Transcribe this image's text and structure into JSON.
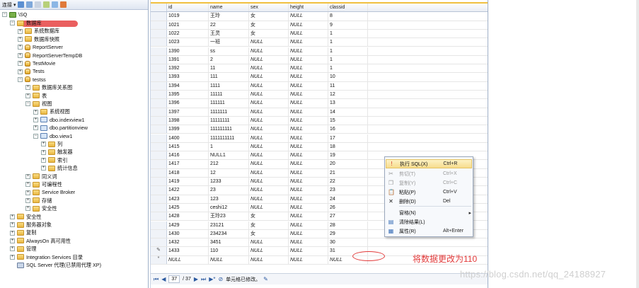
{
  "object_explorer": {
    "toolbar": {
      "connect_label": "连接 ▾"
    },
    "server_name": "\\SQ",
    "tree": [
      {
        "label": "数据库",
        "level": 1,
        "icon": "folder",
        "expand": "minus"
      },
      {
        "label": "系统数据库",
        "level": 2,
        "icon": "folder",
        "expand": "plus"
      },
      {
        "label": "数据库快照",
        "level": 2,
        "icon": "folder",
        "expand": "plus"
      },
      {
        "label": "ReportServer",
        "level": 2,
        "icon": "db",
        "expand": "plus"
      },
      {
        "label": "ReportServerTempDB",
        "level": 2,
        "icon": "db",
        "expand": "plus"
      },
      {
        "label": "TestMovie",
        "level": 2,
        "icon": "db",
        "expand": "plus"
      },
      {
        "label": "Tests",
        "level": 2,
        "icon": "db",
        "expand": "plus"
      },
      {
        "label": "testss",
        "level": 2,
        "icon": "db",
        "expand": "minus"
      },
      {
        "label": "数据库关系图",
        "level": 3,
        "icon": "folder",
        "expand": "plus"
      },
      {
        "label": "表",
        "level": 3,
        "icon": "folder",
        "expand": "plus"
      },
      {
        "label": "视图",
        "level": 3,
        "icon": "folder",
        "expand": "minus"
      },
      {
        "label": "系统视图",
        "level": 4,
        "icon": "folder",
        "expand": "plus"
      },
      {
        "label": "dbo.indexview1",
        "level": 4,
        "icon": "view",
        "expand": "plus"
      },
      {
        "label": "dbo.partitionview",
        "level": 4,
        "icon": "view",
        "expand": "plus"
      },
      {
        "label": "dbo.view1",
        "level": 4,
        "icon": "view",
        "expand": "minus"
      },
      {
        "label": "列",
        "level": 5,
        "icon": "folder",
        "expand": "plus"
      },
      {
        "label": "触发器",
        "level": 5,
        "icon": "folder",
        "expand": "plus"
      },
      {
        "label": "索引",
        "level": 5,
        "icon": "folder",
        "expand": "plus"
      },
      {
        "label": "统计信息",
        "level": 5,
        "icon": "folder",
        "expand": "plus"
      },
      {
        "label": "同义词",
        "level": 3,
        "icon": "folder",
        "expand": "plus"
      },
      {
        "label": "可编程性",
        "level": 3,
        "icon": "folder",
        "expand": "plus"
      },
      {
        "label": "Service Broker",
        "level": 3,
        "icon": "folder",
        "expand": "plus"
      },
      {
        "label": "存储",
        "level": 3,
        "icon": "folder",
        "expand": "plus"
      },
      {
        "label": "安全性",
        "level": 3,
        "icon": "folder",
        "expand": "plus"
      },
      {
        "label": "安全性",
        "level": 1,
        "icon": "folder",
        "expand": "plus"
      },
      {
        "label": "服务器对象",
        "level": 1,
        "icon": "folder",
        "expand": "plus"
      },
      {
        "label": "复制",
        "level": 1,
        "icon": "folder",
        "expand": "plus"
      },
      {
        "label": "AlwaysOn 高可用性",
        "level": 1,
        "icon": "folder",
        "expand": "plus"
      },
      {
        "label": "管理",
        "level": 1,
        "icon": "folder",
        "expand": "plus"
      },
      {
        "label": "Integration Services 目录",
        "level": 1,
        "icon": "folder",
        "expand": "plus"
      },
      {
        "label": "SQL Server 代理(已禁用代理 XP)",
        "level": 1,
        "icon": "agent",
        "expand": "none"
      }
    ]
  },
  "grid": {
    "columns": [
      "id",
      "name",
      "sex",
      "height",
      "classid"
    ],
    "rows": [
      [
        "1019",
        "王玲",
        "女",
        "NULL",
        "8"
      ],
      [
        "1021",
        "22",
        "女",
        "NULL",
        "9"
      ],
      [
        "1022",
        "王灵",
        "女",
        "NULL",
        "1"
      ],
      [
        "1023",
        "一班",
        "NULL",
        "NULL",
        "1"
      ],
      [
        "1390",
        "ss",
        "NULL",
        "NULL",
        "1"
      ],
      [
        "1391",
        "2",
        "NULL",
        "NULL",
        "1"
      ],
      [
        "1392",
        "11",
        "NULL",
        "NULL",
        "1"
      ],
      [
        "1393",
        "111",
        "NULL",
        "NULL",
        "10"
      ],
      [
        "1394",
        "1111",
        "NULL",
        "NULL",
        "11"
      ],
      [
        "1395",
        "11111",
        "NULL",
        "NULL",
        "12"
      ],
      [
        "1396",
        "111111",
        "NULL",
        "NULL",
        "13"
      ],
      [
        "1397",
        "1111111",
        "NULL",
        "NULL",
        "14"
      ],
      [
        "1398",
        "11111111",
        "NULL",
        "NULL",
        "15"
      ],
      [
        "1399",
        "111111111",
        "NULL",
        "NULL",
        "16"
      ],
      [
        "1400",
        "1111111111",
        "NULL",
        "NULL",
        "17"
      ],
      [
        "1415",
        "1",
        "NULL",
        "NULL",
        "18"
      ],
      [
        "1416",
        "NULL1",
        "NULL",
        "NULL",
        "19"
      ],
      [
        "1417",
        "212",
        "NULL",
        "NULL",
        "20"
      ],
      [
        "1418",
        "12",
        "NULL",
        "NULL",
        "21"
      ],
      [
        "1419",
        "1233",
        "NULL",
        "NULL",
        "22"
      ],
      [
        "1422",
        "23",
        "NULL",
        "NULL",
        "23"
      ],
      [
        "1423",
        "123",
        "NULL",
        "NULL",
        "24"
      ],
      [
        "1425",
        "ceshi12",
        "NULL",
        "NULL",
        "26"
      ],
      [
        "1428",
        "王玲23",
        "女",
        "NULL",
        "27"
      ],
      [
        "1429",
        "23121",
        "女",
        "NULL",
        "28"
      ],
      [
        "1430",
        "234234",
        "女",
        "NULL",
        "29"
      ],
      [
        "1432",
        "3451",
        "NULL",
        "NULL",
        "30"
      ],
      [
        "1433",
        "110",
        "NULL",
        "NULL",
        "31"
      ],
      [
        "NULL",
        "NULL",
        "NULL",
        "NULL",
        "NULL"
      ]
    ],
    "row_markers": {
      "27": "✎",
      "28": "*"
    },
    "annotation": "将数据更改为110"
  },
  "navigator": {
    "current": "37",
    "total": "/ 37",
    "status": "单元格已修改。"
  },
  "context_menu": [
    {
      "label": "执行 SQL(X)",
      "shortcut": "Ctrl+R",
      "icon": "!",
      "state": "highlight"
    },
    {
      "label": "剪切(T)",
      "shortcut": "Ctrl+X",
      "icon": "✂",
      "state": "disabled"
    },
    {
      "label": "复制(Y)",
      "shortcut": "Ctrl+C",
      "icon": "❐",
      "state": "disabled"
    },
    {
      "label": "粘贴(P)",
      "shortcut": "Ctrl+V",
      "icon": "📋",
      "state": "normal"
    },
    {
      "label": "删除(D)",
      "shortcut": "Del",
      "icon": "✕",
      "state": "normal"
    },
    {
      "label": "窗格(N)",
      "shortcut": "▸",
      "icon": "",
      "state": "normal"
    },
    {
      "label": "清除结果(L)",
      "shortcut": "",
      "icon": "▤",
      "state": "normal"
    },
    {
      "label": "属性(R)",
      "shortcut": "Alt+Enter",
      "icon": "▦",
      "state": "normal"
    }
  ],
  "watermark": "https://blog.csdn.net/qq_24188927"
}
